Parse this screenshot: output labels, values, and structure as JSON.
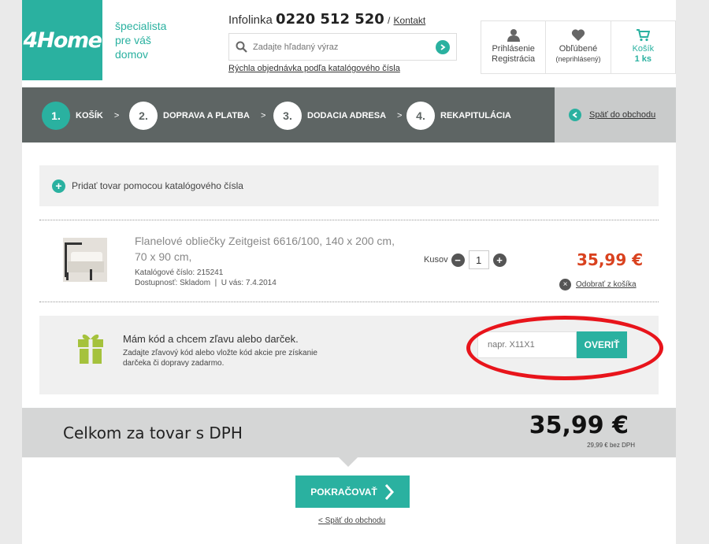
{
  "header": {
    "logo": "4Home",
    "tagline": [
      "špecialista",
      "pre váš",
      "domov"
    ],
    "infolinka_label": "Infolinka",
    "phone": "0220 512 520",
    "separator": "/",
    "contact_link": "Kontakt",
    "search_placeholder": "Zadajte hľadaný výraz",
    "quick_order_link": "Rýchla objednávka podľa katalógového čísla",
    "login_line1": "Prihlásenie",
    "login_line2": "Registrácia",
    "favorites_label": "Obľúbené",
    "favorites_status": "(neprihlásený)",
    "cart_label": "Košík",
    "cart_count": "1 ks"
  },
  "steps": [
    {
      "num": "1.",
      "label": "KOŠÍK"
    },
    {
      "num": "2.",
      "label": "DOPRAVA A PLATBA"
    },
    {
      "num": "3.",
      "label": "DODACIA ADRESA"
    },
    {
      "num": "4.",
      "label": "REKAPITULÁCIA"
    }
  ],
  "step_arrow": ">",
  "back_to_shop": "Späť do obchodu",
  "add_by_catalog": "Pridať tovar pomocou katalógového čísla",
  "product": {
    "name": "Flanelové obliečky Zeitgeist 6616/100, 140 x 200 cm, 70 x 90 cm,",
    "catalog": "Katalógové číslo: 215241",
    "availability": "Dostupnosť: Skladom",
    "divider": "|",
    "delivery": "U vás: 7.4.2014",
    "qty_label": "Kusov",
    "qty": "1",
    "minus": "−",
    "plus": "+",
    "price": "35,99 €",
    "remove": "Odobrať z košíka",
    "remove_icon": "×"
  },
  "discount": {
    "title": "Mám kód a chcem zľavu alebo darček.",
    "text": "Zadajte zľavový kód alebo vložte kód akcie pre získanie darčeka či dopravy zadarmo.",
    "placeholder": "napr. X11X1",
    "verify": "OVERIŤ"
  },
  "total": {
    "label": "Celkom za tovar s DPH",
    "value": "35,99 €",
    "net": "29,99 € bez DPH"
  },
  "continue_label": "POKRAČOVAŤ",
  "back_link": "< Späť do obchodu",
  "colors": {
    "accent": "#2ab1a0",
    "price": "#d9421f",
    "steps_bg": "#5e6564",
    "highlight": "#e8141b"
  }
}
